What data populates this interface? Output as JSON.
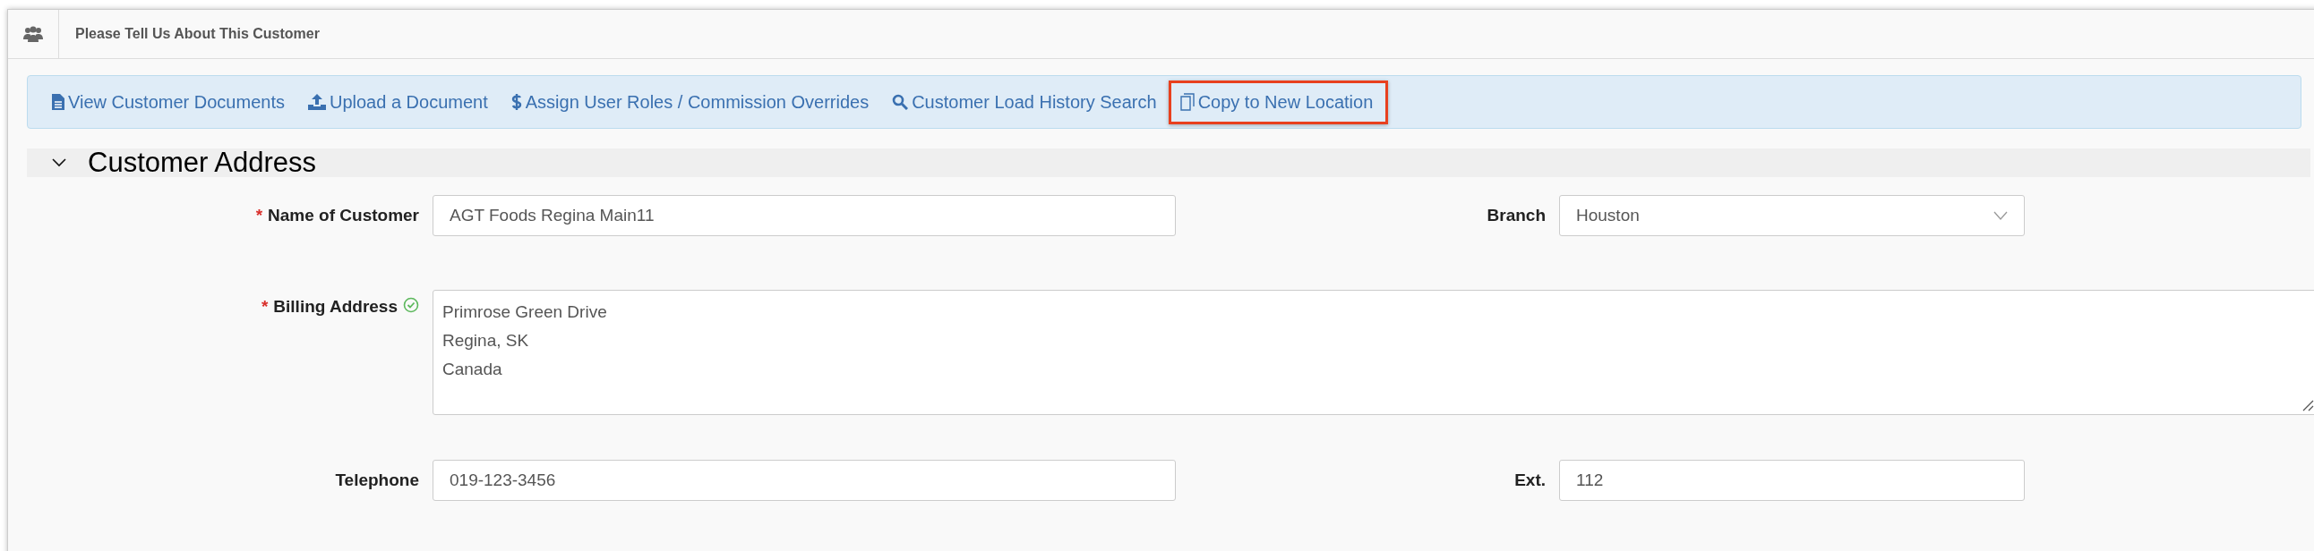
{
  "panel": {
    "title": "Please Tell Us About This Customer"
  },
  "actions": [
    {
      "kind": "document",
      "label": "View Customer Documents",
      "highlighted": false
    },
    {
      "kind": "upload",
      "label": "Upload a Document",
      "highlighted": false
    },
    {
      "kind": "dollar",
      "label": "Assign User Roles / Commission Overrides",
      "highlighted": false
    },
    {
      "kind": "search",
      "label": "Customer Load History Search",
      "highlighted": false
    },
    {
      "kind": "copy",
      "label": "Copy to New Location",
      "highlighted": true
    }
  ],
  "section": {
    "title": "Customer Address",
    "expanded": true
  },
  "fields": {
    "name": {
      "required_mark": "*",
      "label": "Name of Customer",
      "value": "AGT Foods Regina Main11"
    },
    "branch": {
      "label": "Branch",
      "value": "Houston"
    },
    "billing": {
      "required_mark": "*",
      "label": "Billing Address",
      "verified": true,
      "lines": [
        "Primrose Green Drive",
        "Regina, SK",
        "Canada"
      ]
    },
    "telephone": {
      "label": "Telephone",
      "value": "019-123-3456"
    },
    "ext": {
      "label": "Ext.",
      "value": "112"
    }
  }
}
